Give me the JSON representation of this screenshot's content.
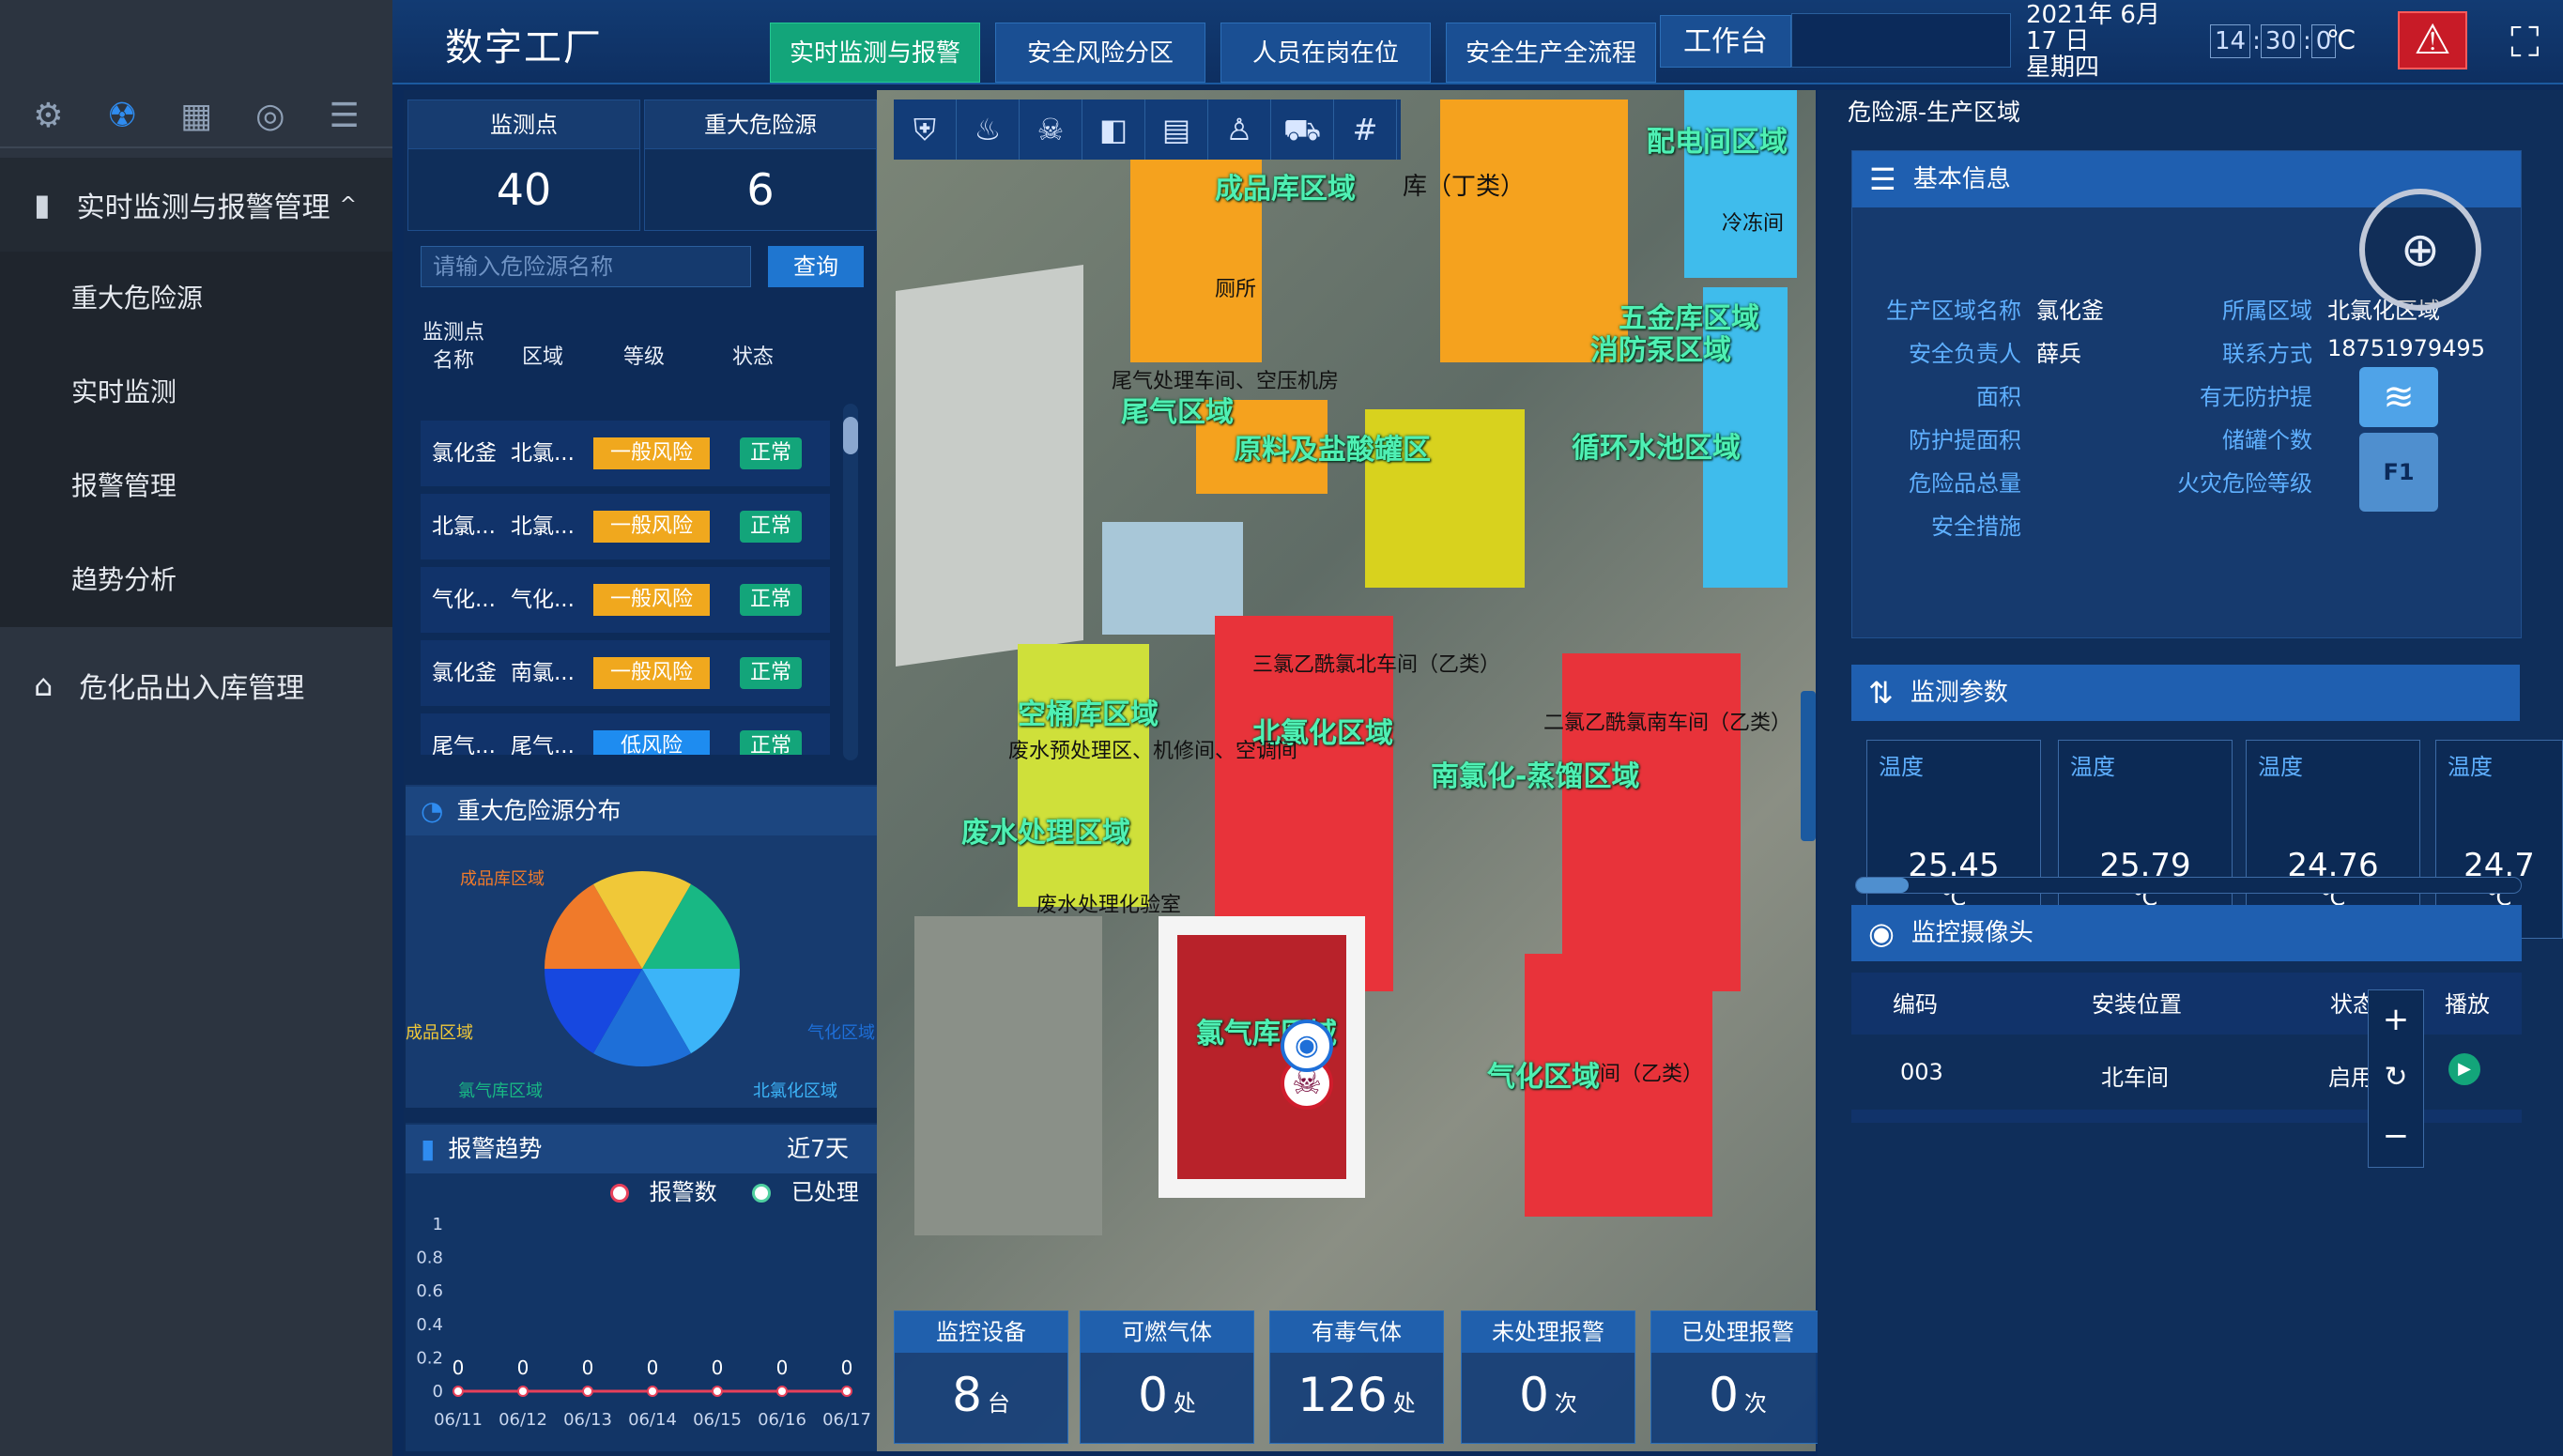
{
  "sidebar": {
    "menu_title": "实时监测与报警管理",
    "submenu": [
      "重大危险源",
      "实时监测",
      "报警管理",
      "趋势分析"
    ],
    "menu2": "危化品出入库管理"
  },
  "header": {
    "app_title": "数字工厂",
    "tabs": [
      "实时监测与报警",
      "安全风险分区",
      "人员在岗在位",
      "安全生产全流程"
    ],
    "workbench": "工作台",
    "date": "2021年 6月 17 日",
    "weekday": "星期四",
    "clock": [
      "14",
      "30",
      "0"
    ],
    "temp_unit": "℃"
  },
  "stats": {
    "monitor_label": "监测点",
    "monitor_value": "40",
    "hazard_label": "重大危险源",
    "hazard_value": "6"
  },
  "search": {
    "placeholder": "请输入危险源名称",
    "button": "查询"
  },
  "table": {
    "headers": [
      "监测点名称",
      "区域",
      "等级",
      "状态"
    ],
    "rows": [
      {
        "name": "氯化釜",
        "area": "北氯...",
        "level": "一般风险",
        "status": "正常",
        "lv": "mid"
      },
      {
        "name": "北氯...",
        "area": "北氯...",
        "level": "一般风险",
        "status": "正常",
        "lv": "mid"
      },
      {
        "name": "气化...",
        "area": "气化...",
        "level": "一般风险",
        "status": "正常",
        "lv": "mid"
      },
      {
        "name": "氯化釜",
        "area": "南氯...",
        "level": "一般风险",
        "status": "正常",
        "lv": "mid"
      },
      {
        "name": "尾气...",
        "area": "尾气...",
        "level": "低风险",
        "status": "正常",
        "lv": "low"
      }
    ]
  },
  "pie": {
    "title": "重大危险源分布",
    "labels": [
      "成品库区域",
      "成品区域",
      "氯气库区域",
      "北氯化区域",
      "气化区域"
    ],
    "colors": [
      "#f07a2a",
      "#f0c838",
      "#18b884",
      "#3cb4f8",
      "#1e6fd8",
      "#1748e0"
    ]
  },
  "trend": {
    "title": "报警趋势",
    "range": "近7天",
    "legend_alarm": "报警数",
    "legend_done": "已处理",
    "y_ticks": [
      "1",
      "0.8",
      "0.6",
      "0.4",
      "0.2",
      "0"
    ],
    "x_ticks": [
      "06/11",
      "06/12",
      "06/13",
      "06/14",
      "06/15",
      "06/16",
      "06/17"
    ],
    "values": [
      "0",
      "0",
      "0",
      "0",
      "0",
      "0",
      "0"
    ]
  },
  "map": {
    "labels": [
      "配电间区域",
      "成品库区域",
      "库（丁类）",
      "五金库区域",
      "消防泵区域",
      "尾气区域",
      "原料及盐酸罐区",
      "循环水池区域",
      "空桶库区域",
      "北氯化区域",
      "南氯化-蒸馏区域",
      "废水处理区域",
      "氯气库区域",
      "气化区域"
    ],
    "texts": [
      "冷冻间",
      "厕所",
      "尾气处理车间、空压机房",
      "三氯乙酰氯北车间（乙类）",
      "二氯乙酰氯南车间（乙类）",
      "废水预处理区、机修间、空调间",
      "废水处理化验室",
      "间（乙类）"
    ]
  },
  "bottom_stats": [
    {
      "label": "监控设备",
      "value": "8",
      "unit": "台"
    },
    {
      "label": "可燃气体",
      "value": "0",
      "unit": "处"
    },
    {
      "label": "有毒气体",
      "value": "126",
      "unit": "处"
    },
    {
      "label": "未处理报警",
      "value": "0",
      "unit": "次"
    },
    {
      "label": "已处理报警",
      "value": "0",
      "unit": "次"
    }
  ],
  "right": {
    "title": "危险源-生产区域",
    "basic_title": "基本信息",
    "basic": {
      "area_name_l": "生产区域名称",
      "area_name_v": "氯化釜",
      "region_l": "所属区域",
      "region_v": "北氯化区域",
      "owner_l": "安全负责人",
      "owner_v": "薛兵",
      "contact_l": "联系方式",
      "contact_v": "18751979495",
      "size_l": "面积",
      "dike_l": "有无防护提",
      "dike_area_l": "防护提面积",
      "tanks_l": "储罐个数",
      "total_l": "危险品总量",
      "fire_l": "火灾危险等级",
      "measures_l": "安全措施"
    },
    "floor": "F1",
    "params_title": "监测参数",
    "temps": [
      {
        "label": "温度",
        "value": "25.45",
        "unit": "℃"
      },
      {
        "label": "温度",
        "value": "25.79",
        "unit": "℃"
      },
      {
        "label": "温度",
        "value": "24.76",
        "unit": "℃"
      },
      {
        "label": "温度",
        "value": "24.7",
        "unit": "℃"
      }
    ],
    "camera_title": "监控摄像头",
    "cam_headers": [
      "编码",
      "安装位置",
      "状态",
      "播放"
    ],
    "cam_row": {
      "code": "003",
      "loc": "北车间",
      "status": "启用"
    }
  }
}
